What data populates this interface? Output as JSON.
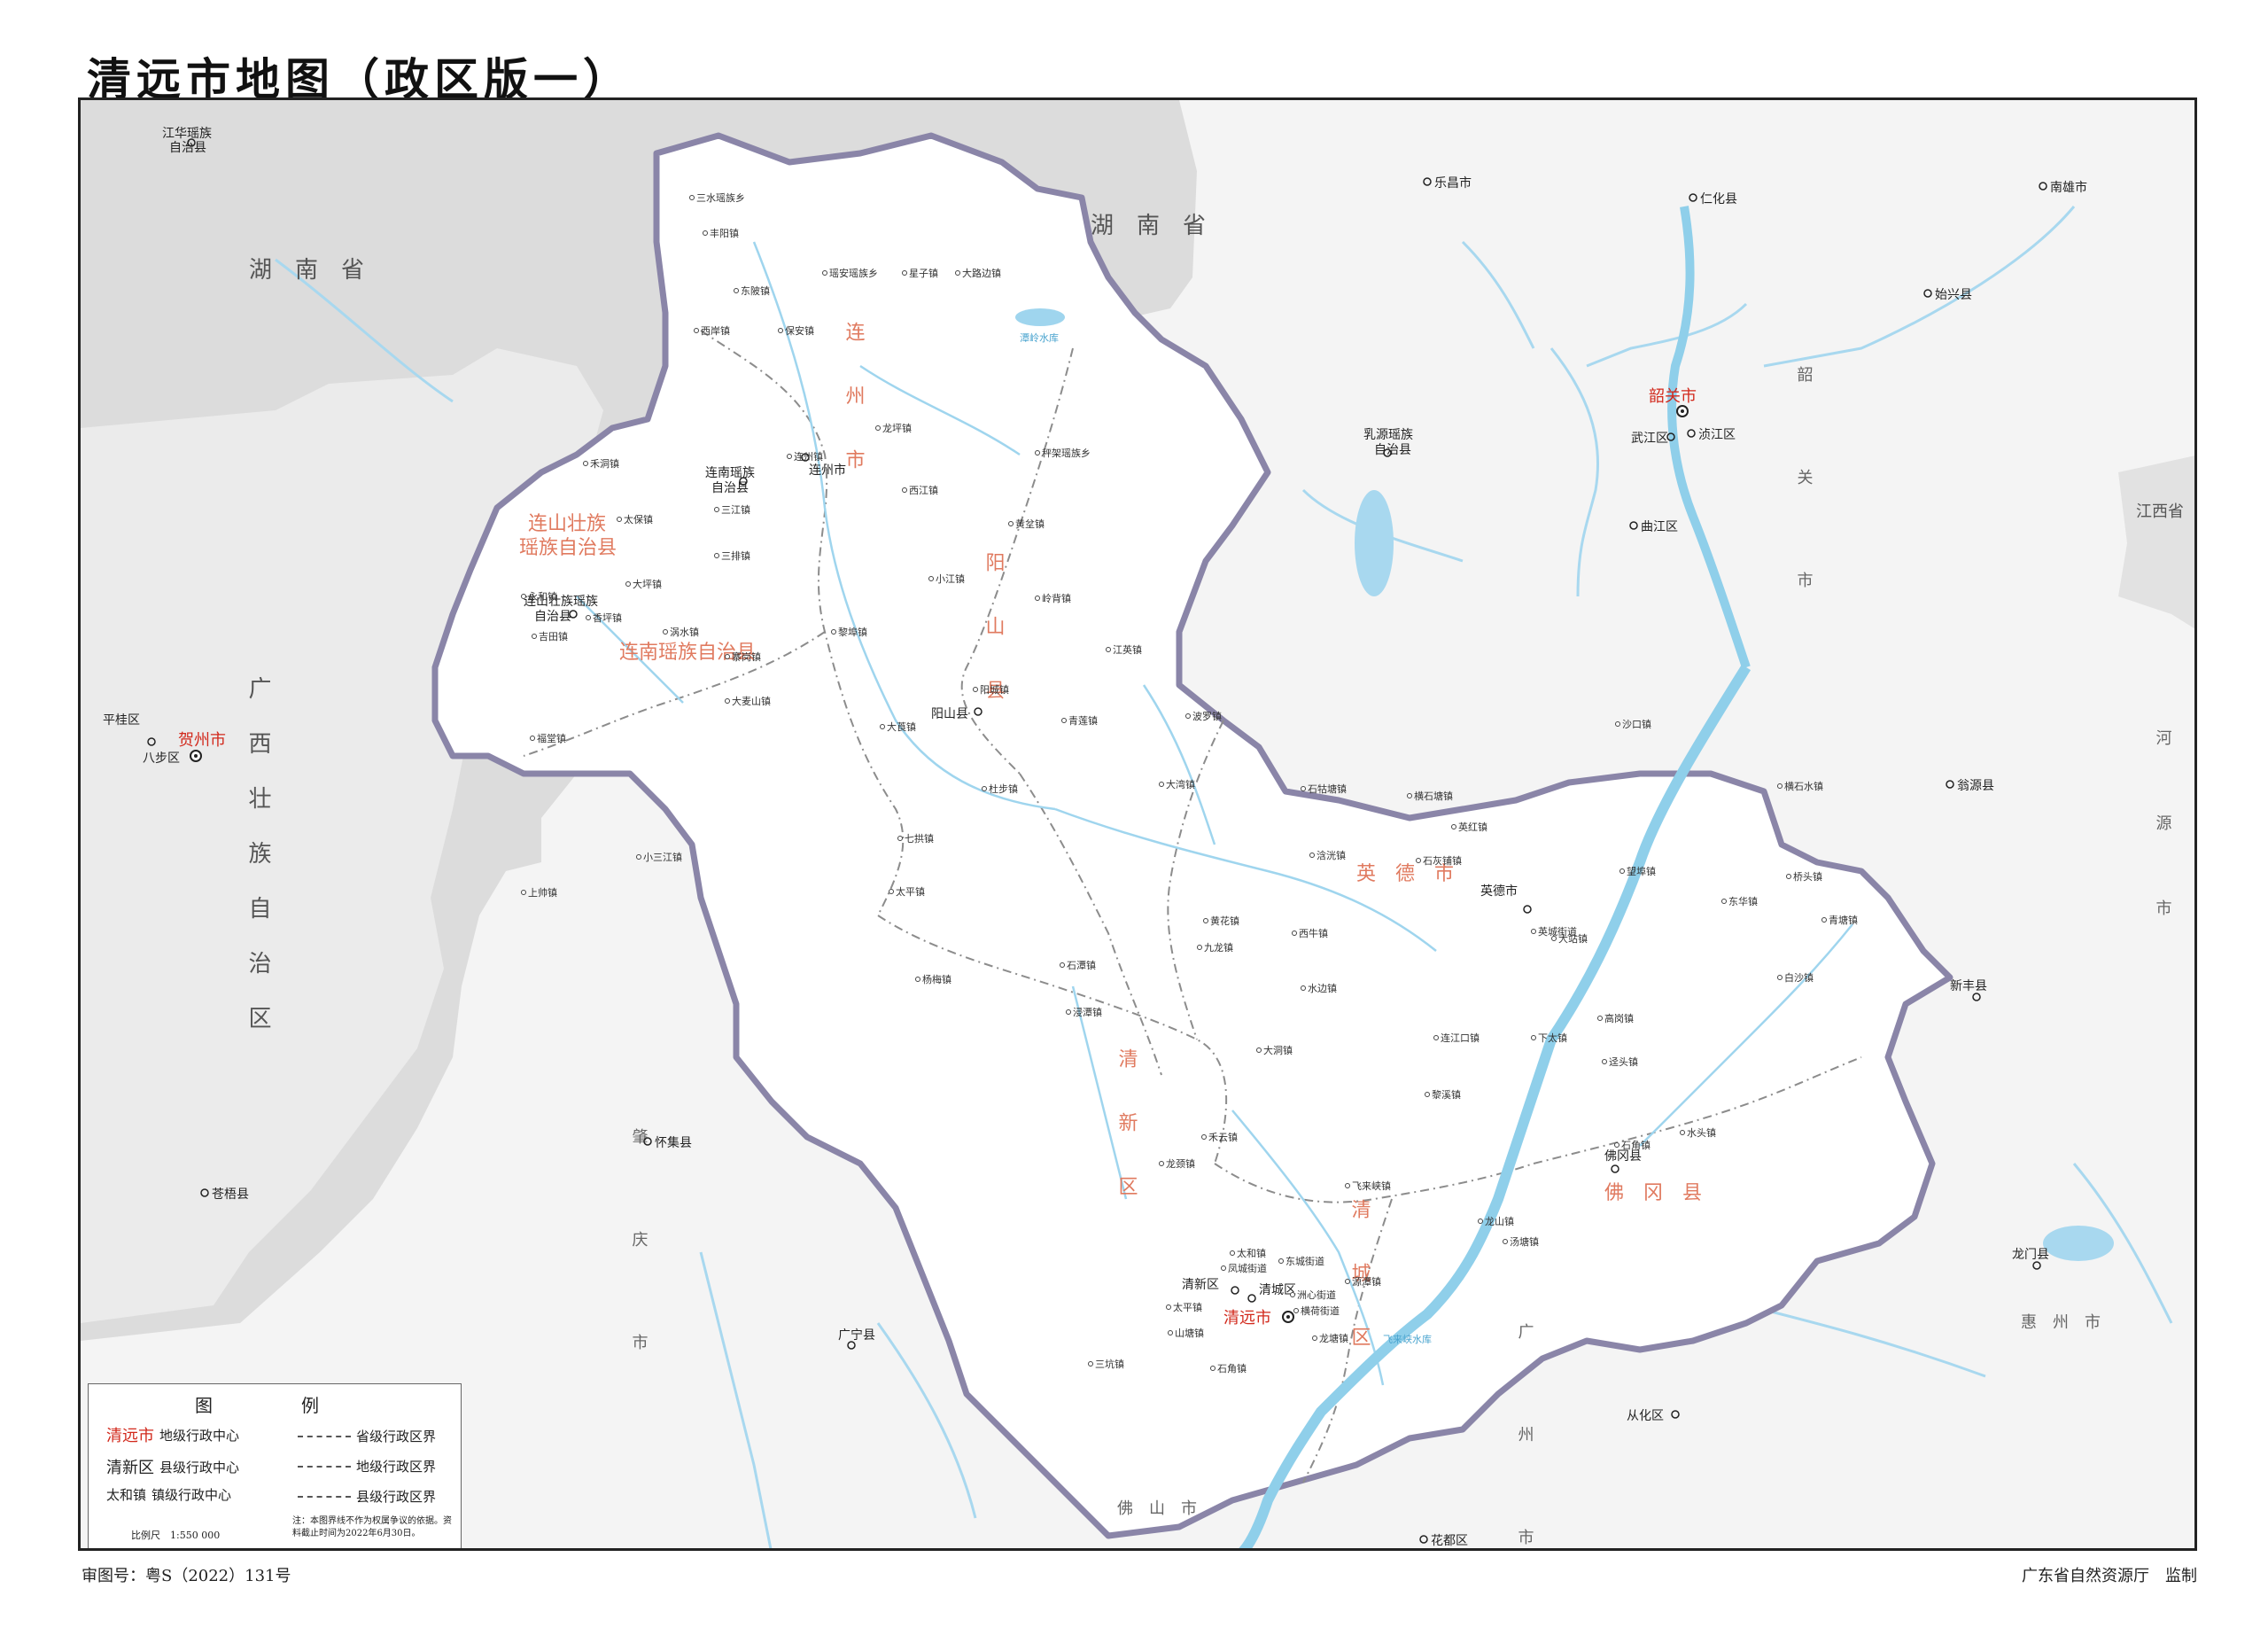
{
  "title": "清远市地图（政区版一）",
  "footer": {
    "review_no": "审图号：粤S（2022）131号",
    "credit": "广东省自然资源厅　监制"
  },
  "provinces": {
    "hunan_top": "湖　南　省",
    "hunan_left": "湖　南　省",
    "guangxi": "广西壮族自治区",
    "jiangxi": "江西省"
  },
  "counties_big": {
    "lianzhou": "连　州　市",
    "yangshan": "阳　山　县",
    "lianshan": [
      "连山壮族",
      "瑶族自治县"
    ],
    "liannan": "连南瑶族自治县",
    "yingde": "英　德　市",
    "qingxin": "清　新　区",
    "qingcheng": "清　城　区",
    "fogang": "佛　冈　县",
    "shaoguan_pref": "韶　关　市",
    "zhaoqing_pref": "肇　庆　市",
    "guangzhou_pref": "广　州　市",
    "huizhou_pref": "惠　州　市",
    "heyuan_pref": "河　源　市",
    "foshan_pref": "佛　山　市"
  },
  "cities_red": {
    "qingyuan": "清远市",
    "shaoguan": "韶关市",
    "hezhou": "贺州市"
  },
  "county_seats": {
    "lianzhou": "连州市",
    "liannan": [
      "连南瑶族",
      "自治县"
    ],
    "lianshan": [
      "连山壮族瑶族",
      "自治县"
    ],
    "yangshan": "阳山县",
    "yingde": "英德市",
    "fogang": "佛冈县",
    "qingxin": "清新区",
    "qingcheng": "清城区",
    "lechang": "乐昌市",
    "renhua": "仁化县",
    "nanxiong": "南雄市",
    "shixing": "始兴县",
    "ruyuan": [
      "乳源瑶族",
      "自治县"
    ],
    "wujiang": "武江区",
    "zhenjiang": "浈江区",
    "qujiang": "曲江区",
    "wengyuan": "翁源县",
    "xinfeng": "新丰县",
    "longmen": "龙门县",
    "conghua": "从化区",
    "huadu": "花都区",
    "guangning": "广宁县",
    "huaiji": "怀集县",
    "cangwu": "苍梧县",
    "pinggui": "平桂区",
    "babu": "八步区",
    "jianghua": [
      "江华瑶族",
      "自治县"
    ]
  },
  "towns": [
    "三水瑶族乡",
    "丰阳镇",
    "瑶安瑶族乡",
    "星子镇",
    "大路边镇",
    "东陂镇",
    "西岸镇",
    "保安镇",
    "龙坪镇",
    "连州镇",
    "西江镇",
    "秤架瑶族乡",
    "黄坌镇",
    "岭背镇",
    "小江镇",
    "黎埠镇",
    "江英镇",
    "阳城镇",
    "大莨镇",
    "青莲镇",
    "杜步镇",
    "七拱镇",
    "太平镇",
    "杨梅镇",
    "禾洞镇",
    "太保镇",
    "三江镇",
    "三排镇",
    "大坪镇",
    "永和镇",
    "香坪镇",
    "吉田镇",
    "涡水镇",
    "寨岗镇",
    "大麦山镇",
    "福堂镇",
    "小三江镇",
    "上帅镇",
    "波罗镇",
    "大湾镇",
    "石牯塘镇",
    "横石塘镇",
    "英红镇",
    "沙口镇",
    "浛洸镇",
    "石灰铺镇",
    "望埠镇",
    "横石水镇",
    "东华镇",
    "桥头镇",
    "青塘镇",
    "黄花镇",
    "九龙镇",
    "西牛镇",
    "英城街道",
    "大站镇",
    "白沙镇",
    "水边镇",
    "大洞镇",
    "连江口镇",
    "下太镇",
    "高岗镇",
    "迳头镇",
    "黎溪镇",
    "水头镇",
    "石角镇",
    "石潭镇",
    "浸潭镇",
    "禾云镇",
    "龙颈镇",
    "太和镇",
    "东城街道",
    "凤城街道",
    "洲心街道",
    "横荷街道",
    "源潭镇",
    "飞来峡镇",
    "龙山镇",
    "汤塘镇",
    "太平镇",
    "山塘镇",
    "三坑镇",
    "石角镇",
    "龙塘镇"
  ],
  "reservoirs": {
    "chaoxi": "潭岭水库",
    "feilaixia": "飞来峡水库"
  },
  "legend": {
    "title": "图　例",
    "pref_seat": "清远市",
    "pref_seat_desc": "地级行政中心",
    "county_seat": "清新区",
    "county_seat_desc": "县级行政中心",
    "town": "太和镇",
    "town_desc": "镇级行政中心",
    "b1": "省级行政区界",
    "b2": "地级行政区界",
    "b3": "县级行政区界",
    "scale": "比例尺　1:550 000",
    "note": "注：本图界线不作为权属争议的依据。资料截止时间为2022年6月30日。"
  },
  "colors": {
    "region": "#ffffff",
    "outside": "#f2f2f2",
    "province_shade": "#d8d8d8",
    "boundary": "#8a85a8",
    "river": "#9fd5ee",
    "red_text": "#d2291c",
    "county_text": "#e07a5f"
  }
}
